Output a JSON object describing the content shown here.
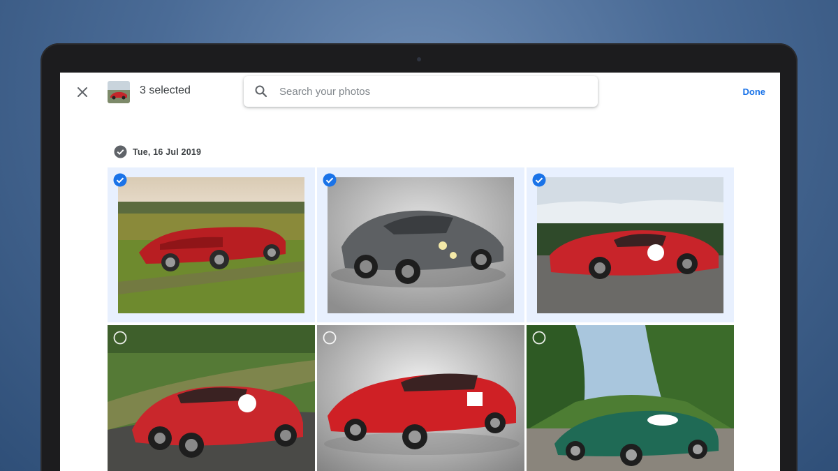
{
  "header": {
    "selected_text": "3 selected",
    "search_placeholder": "Search your photos",
    "done_label": "Done"
  },
  "date_group": {
    "label": "Tue, 16 Jul 2019"
  },
  "photos": [
    {
      "description": "red convertible",
      "selected": true
    },
    {
      "description": "grey coupe",
      "selected": true
    },
    {
      "description": "red coupe 23",
      "selected": true
    },
    {
      "description": "red coupe 23 track",
      "selected": false
    },
    {
      "description": "red coupe studio",
      "selected": false
    },
    {
      "description": "green roadster",
      "selected": false
    }
  ],
  "colors": {
    "accent": "#1a73e8",
    "selected_tile_bg": "#e8f0fe"
  }
}
